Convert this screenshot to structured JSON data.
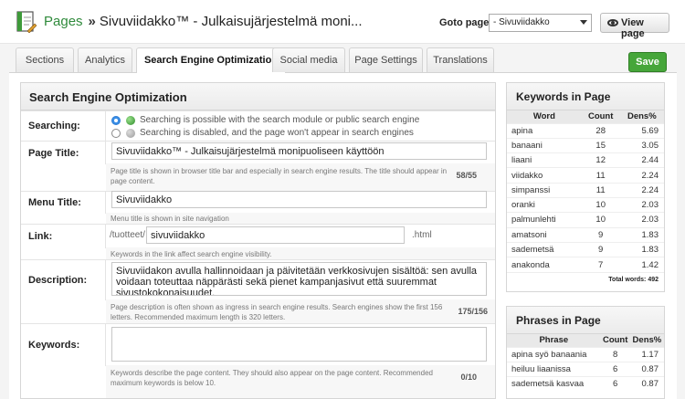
{
  "header": {
    "breadcrumb_root": "Pages",
    "breadcrumb_separator": "»",
    "page_title": "Sivuviidakko™ - Julkaisujärjestelmä moni...",
    "goto_label": "Goto page:",
    "goto_value": "- Sivuviidakko",
    "view_button": "View page"
  },
  "tabs": [
    "Sections",
    "Analytics",
    "Search Engine Optimization",
    "Social media",
    "Page Settings",
    "Translations"
  ],
  "active_tab": "Search Engine Optimization",
  "save_button": "Save",
  "seo": {
    "heading": "Search Engine Optimization",
    "searching": {
      "label": "Searching:",
      "option_enabled": "Searching is possible with the search module or public search engine",
      "option_disabled": "Searching is disabled, and the page won't appear in search engines",
      "selected": "enabled"
    },
    "page_title": {
      "label": "Page Title:",
      "value": "Sivuviidakko™ - Julkaisujärjestelmä monipuoliseen käyttöön",
      "help": "Page title is shown in browser title bar and especially in search engine results. The title should appear in page content.",
      "counter": "58/55"
    },
    "menu_title": {
      "label": "Menu Title:",
      "value": "Sivuviidakko",
      "help": "Menu title is shown in site navigation"
    },
    "link": {
      "label": "Link:",
      "prefix": "/tuotteet/",
      "value": "sivuviidakko",
      "suffix": ".html",
      "help": "Keywords in the link affect search engine visibility."
    },
    "description": {
      "label": "Description:",
      "value": "Sivuviidakon avulla hallinnoidaan ja päivitetään verkkosivujen sisältöä: sen avulla voidaan toteuttaa näppärästi sekä pienet kampanjasivut että suuremmat sivustokokonaisuudet.",
      "help": "Page description is often shown as ingress in search engine results. Search engines show the first 156 letters. Recommended maximum length is 320 letters.",
      "counter": "175/156"
    },
    "keywords": {
      "label": "Keywords:",
      "value": "",
      "help": "Keywords describe the page content. They should also appear on the page content. Recommended maximum keywords is below 10.",
      "counter": "0/10"
    }
  },
  "keywords_panel": {
    "heading": "Keywords in Page",
    "columns": [
      "Word",
      "Count",
      "Dens%"
    ],
    "rows": [
      [
        "apina",
        "28",
        "5.69"
      ],
      [
        "banaani",
        "15",
        "3.05"
      ],
      [
        "liaani",
        "12",
        "2.44"
      ],
      [
        "viidakko",
        "11",
        "2.24"
      ],
      [
        "simpanssi",
        "11",
        "2.24"
      ],
      [
        "oranki",
        "10",
        "2.03"
      ],
      [
        "palmunlehti",
        "10",
        "2.03"
      ],
      [
        "amatsoni",
        "9",
        "1.83"
      ],
      [
        "sademetsä",
        "9",
        "1.83"
      ],
      [
        "anakonda",
        "7",
        "1.42"
      ]
    ],
    "total": "Total words: 492"
  },
  "phrases_panel": {
    "heading": "Phrases in Page",
    "columns": [
      "Phrase",
      "Count",
      "Dens%"
    ],
    "rows": [
      [
        "apina syö banaania",
        "8",
        "1.17"
      ],
      [
        "heiluu liaanissa",
        "6",
        "0.87"
      ],
      [
        "sademetsä kasvaa",
        "6",
        "0.87"
      ]
    ]
  }
}
